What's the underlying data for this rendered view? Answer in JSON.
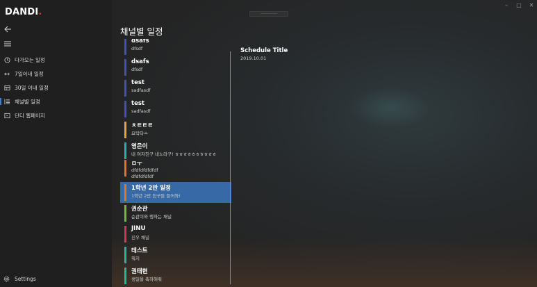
{
  "app": {
    "name": "DANDI",
    "name_dot": "."
  },
  "sidebar": {
    "items": [
      {
        "label": "다가오는 일정",
        "icon": "clock-icon"
      },
      {
        "label": "7일이내 일정",
        "icon": "range-icon"
      },
      {
        "label": "30일 이내 일정",
        "icon": "calendar-icon"
      },
      {
        "label": "채널별 일정",
        "icon": "list-icon"
      },
      {
        "label": "단디 웹페이지",
        "icon": "web-icon"
      }
    ],
    "active_index": 3,
    "settings_label": "Settings"
  },
  "page": {
    "title": "채널별 일정"
  },
  "channels": [
    {
      "name": "dsafs",
      "desc": "dfsdf",
      "color": "#4a4fb8"
    },
    {
      "name": "dsafs",
      "desc": "dfsdf",
      "color": "#4a4fb8"
    },
    {
      "name": "test",
      "desc": "sadfasdf",
      "color": "#4a4fb8"
    },
    {
      "name": "test",
      "desc": "sadfasdf",
      "color": "#4a4fb8"
    },
    {
      "name": "ㅊㅌㅌㅌ",
      "desc": "요탁타ㅛ",
      "color": "#e6a33a"
    },
    {
      "name": "영은이",
      "desc": "내 여자친구 내노라구! ㅎㅎㅎㅎㅎㅎㅎㅎㅎㅎ",
      "color": "#22b5a8"
    },
    {
      "name": "ㅁㅜ",
      "desc": "dfdfdfdfdfdf\ndfdfdfdfdf",
      "color": "#e0752b"
    },
    {
      "name": "1학년 2반 일정",
      "desc": "1학년 2반 친구들 들어와!",
      "color": "#e0752b"
    },
    {
      "name": "권순관",
      "desc": "순관이와 행하는 채널",
      "color": "#6cbe3a"
    },
    {
      "name": "JINU",
      "desc": "진우 채널",
      "color": "#d8355a"
    },
    {
      "name": "테스트",
      "desc": "뭐지",
      "color": "#22b5a8"
    },
    {
      "name": "권태현",
      "desc": "생일을 축하해줘",
      "color": "#22b5a8"
    }
  ],
  "selected_channel_index": 7,
  "detail": {
    "title": "Schedule Title",
    "date": "2019.10.01"
  },
  "window_controls": {
    "minimize": "–",
    "maximize": "□",
    "close": "✕"
  }
}
